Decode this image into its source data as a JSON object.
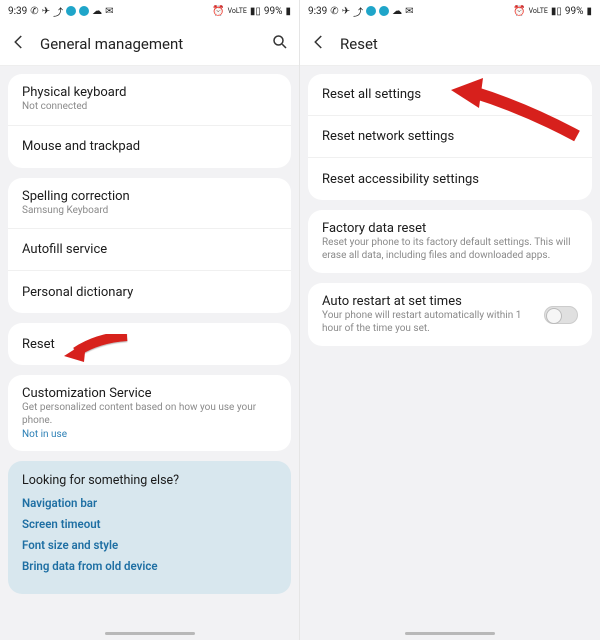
{
  "status": {
    "time": "9:39",
    "battery": "99%"
  },
  "left": {
    "title": "General management",
    "rows": {
      "physical_keyboard": {
        "label": "Physical keyboard",
        "sub": "Not connected"
      },
      "mouse_trackpad": {
        "label": "Mouse and trackpad"
      },
      "spelling": {
        "label": "Spelling correction",
        "sub": "Samsung Keyboard"
      },
      "autofill": {
        "label": "Autofill service"
      },
      "dictionary": {
        "label": "Personal dictionary"
      },
      "reset": {
        "label": "Reset"
      },
      "customization": {
        "label": "Customization Service",
        "sub": "Get personalized content based on how you use your phone.",
        "link": "Not in use"
      }
    },
    "looking": {
      "heading": "Looking for something else?",
      "links": [
        "Navigation bar",
        "Screen timeout",
        "Font size and style",
        "Bring data from old device"
      ]
    }
  },
  "right": {
    "title": "Reset",
    "rows": {
      "reset_all": {
        "label": "Reset all settings"
      },
      "reset_network": {
        "label": "Reset network settings"
      },
      "reset_access": {
        "label": "Reset accessibility settings"
      },
      "factory": {
        "label": "Factory data reset",
        "sub": "Reset your phone to its factory default settings. This will erase all data, including files and downloaded apps."
      },
      "autorestart": {
        "label": "Auto restart at set times",
        "sub": "Your phone will restart automatically within 1 hour of the time you set."
      }
    }
  }
}
